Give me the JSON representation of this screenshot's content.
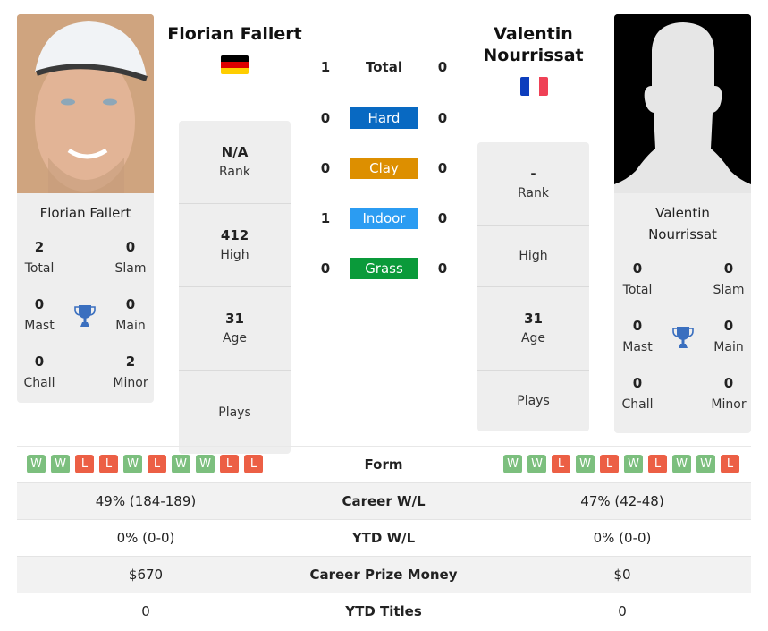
{
  "player1": {
    "name": "Florian Fallert",
    "card_name": "Florian Fallert",
    "country_flag": "germany-flag",
    "flag_colors": [
      "#000000",
      "#dd0000",
      "#ffce00"
    ],
    "titles": {
      "total": {
        "value": "2",
        "label": "Total"
      },
      "slam": {
        "value": "0",
        "label": "Slam"
      },
      "mast": {
        "value": "0",
        "label": "Mast"
      },
      "main": {
        "value": "0",
        "label": "Main"
      },
      "chall": {
        "value": "0",
        "label": "Chall"
      },
      "minor": {
        "value": "2",
        "label": "Minor"
      }
    },
    "stats": {
      "rank": {
        "value": "N/A",
        "label": "Rank"
      },
      "high": {
        "value": "412",
        "label": "High"
      },
      "age": {
        "value": "31",
        "label": "Age"
      },
      "plays": {
        "value": "",
        "label": "Plays"
      }
    },
    "form": [
      "W",
      "W",
      "L",
      "L",
      "W",
      "L",
      "W",
      "W",
      "L",
      "L"
    ]
  },
  "player2": {
    "name": "Valentin Nourrissat",
    "name_line1": "Valentin",
    "name_line2": "Nourrissat",
    "card_name_line1": "Valentin",
    "card_name_line2": "Nourrissat",
    "country_flag": "france-flag",
    "flag_colors": [
      "#0d3ebd",
      "#ffffff",
      "#ef4156"
    ],
    "titles": {
      "total": {
        "value": "0",
        "label": "Total"
      },
      "slam": {
        "value": "0",
        "label": "Slam"
      },
      "mast": {
        "value": "0",
        "label": "Mast"
      },
      "main": {
        "value": "0",
        "label": "Main"
      },
      "chall": {
        "value": "0",
        "label": "Chall"
      },
      "minor": {
        "value": "0",
        "label": "Minor"
      }
    },
    "stats": {
      "rank": {
        "value": "-",
        "label": "Rank"
      },
      "high": {
        "value": "",
        "label": "High"
      },
      "age": {
        "value": "31",
        "label": "Age"
      },
      "plays": {
        "value": "",
        "label": "Plays"
      }
    },
    "form": [
      "W",
      "W",
      "L",
      "W",
      "L",
      "W",
      "L",
      "W",
      "W",
      "L"
    ]
  },
  "h2h": [
    {
      "label": "Total",
      "p1": "1",
      "p2": "0",
      "color": ""
    },
    {
      "label": "Hard",
      "p1": "0",
      "p2": "0",
      "color": "#0869c2"
    },
    {
      "label": "Clay",
      "p1": "0",
      "p2": "0",
      "color": "#dd8f00"
    },
    {
      "label": "Indoor",
      "p1": "1",
      "p2": "0",
      "color": "#2b9cf2"
    },
    {
      "label": "Grass",
      "p1": "0",
      "p2": "0",
      "color": "#0a9a3a"
    }
  ],
  "form_label": "Form",
  "table": [
    {
      "label": "Career W/L",
      "p1": "49% (184-189)",
      "p2": "47% (42-48)"
    },
    {
      "label": "YTD W/L",
      "p1": "0% (0-0)",
      "p2": "0% (0-0)"
    },
    {
      "label": "Career Prize Money",
      "p1": "$670",
      "p2": "$0"
    },
    {
      "label": "YTD Titles",
      "p1": "0",
      "p2": "0"
    }
  ],
  "colors": {
    "win": "#7cbf7e",
    "loss": "#ec5f45",
    "trophy": "#3a6fbf",
    "panel": "#eeeeee"
  }
}
